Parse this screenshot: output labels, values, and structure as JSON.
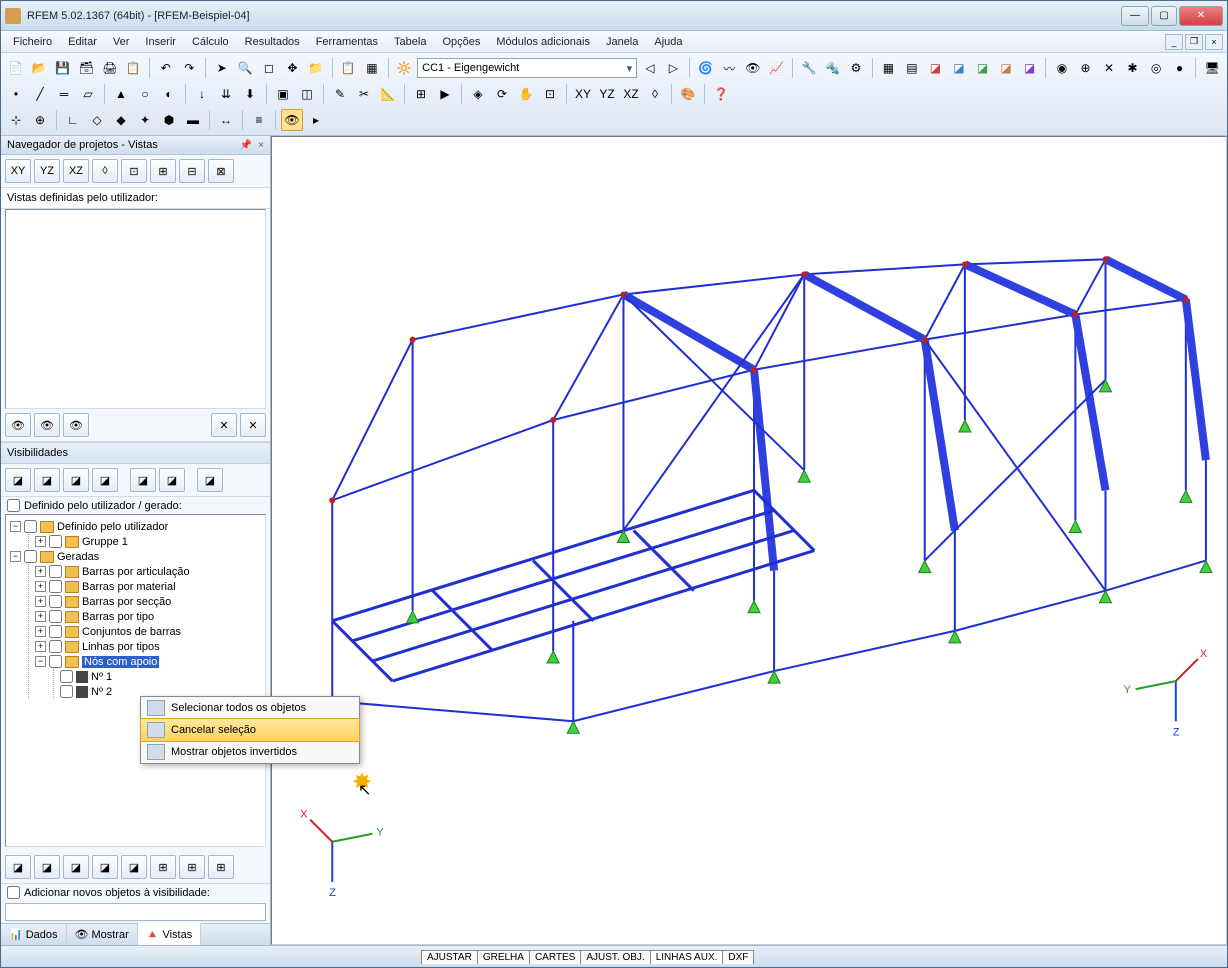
{
  "title": "RFEM 5.02.1367 (64bit) - [RFEM-Beispiel-04]",
  "menu": [
    "Ficheiro",
    "Editar",
    "Ver",
    "Inserir",
    "Cálculo",
    "Resultados",
    "Ferramentas",
    "Tabela",
    "Opções",
    "Módulos adicionais",
    "Janela",
    "Ajuda"
  ],
  "load_combo": "CC1 - Eigengewicht",
  "sidebar": {
    "title": "Navegador de projetos - Vistas",
    "views_label": "Vistas definidas pelo utilizador:",
    "vis_title": "Visibilidades",
    "user_gen_check": "Definido pelo utilizador / gerado:",
    "tree": {
      "root1": "Definido pelo utilizador",
      "root1_child": "Gruppe 1",
      "root2": "Geradas",
      "items": [
        "Barras por articulação",
        "Barras por material",
        "Barras por secção",
        "Barras por tipo",
        "Conjuntos de barras",
        "Linhas por tipos"
      ],
      "selected": "Nós com apoio",
      "sub1": "Nº 1",
      "sub2": "Nº 2"
    },
    "add_objects": "Adicionar novos objetos à visibilidade:",
    "tabs": [
      "Dados",
      "Mostrar",
      "Vistas"
    ]
  },
  "context_menu": {
    "item1": "Selecionar todos os objetos",
    "item2": "Cancelar seleção",
    "item3": "Mostrar objetos invertidos"
  },
  "status_tabs": [
    "AJUSTAR",
    "GRELHA",
    "CARTES",
    "AJUST. OBJ.",
    "LINHAS AUX.",
    "DXF"
  ],
  "axes": {
    "x": "X",
    "y": "Y",
    "z": "Z"
  }
}
